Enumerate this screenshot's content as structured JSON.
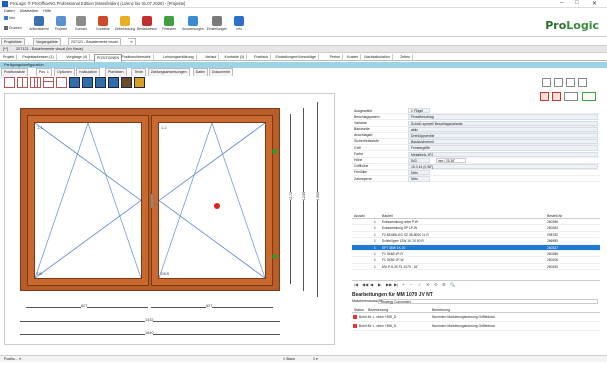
{
  "window": {
    "title": "ProLogic ® ProOfficeNG Professional Edition (Mossfelden) (Lizenz bis 31.07.2025) - [Projekte]",
    "min": "–",
    "max": "□",
    "close": "✕"
  },
  "menu": [
    "Daten",
    "Illustration",
    "Hilfe"
  ],
  "ribbon": {
    "small": [
      {
        "label": "Neu",
        "icon": "new-icon"
      },
      {
        "label": "Drucken",
        "icon": "print-icon"
      }
    ],
    "large": [
      {
        "label": "Artikelstamm",
        "icon": "articles-icon",
        "color": "#3a6fb0"
      },
      {
        "label": "Projekte",
        "icon": "projects-icon",
        "color": "#5a8fd0"
      },
      {
        "label": "Kontakt",
        "icon": "contact-icon",
        "color": "#8a8a8a"
      },
      {
        "label": "Kontakte",
        "icon": "contacts-icon",
        "color": "#d04a2a"
      },
      {
        "label": "Zeiterfassung",
        "icon": "time-icon",
        "color": "#e8b020"
      },
      {
        "label": "Bestellwesen",
        "icon": "order-icon",
        "color": "#c03030"
      },
      {
        "label": "Finanzen",
        "icon": "finance-icon",
        "color": "#40a040"
      },
      {
        "label": "Auswertungen",
        "icon": "chart-icon",
        "color": "#3a8ad0"
      },
      {
        "label": "Einstellungen",
        "icon": "settings-icon",
        "color": "#7a7a7a"
      },
      {
        "label": "Info",
        "icon": "info-icon",
        "color": "#2a70c8"
      }
    ],
    "logo_a": "Pro",
    "logo_b": "Logic"
  },
  "doc_tabs": [
    "Projektliste",
    "Vorgangsliste",
    "207121 - Bauelemente visual",
    "✕"
  ],
  "pathbar": {
    "text": "207121 - Bauelemente visual (Im Haus)",
    "marker": "[**]"
  },
  "section_tabs": [
    "Projekt",
    "Projektadressen (1)",
    "Vorgänge (4)",
    "POSITIONEN",
    "Positionsübersicht",
    "Leistungserklärung",
    "Verlauf",
    "Kontakte (3)",
    "Postfach",
    "Einstellungen/Vorschläge",
    "Preise",
    "Kosten",
    "Nachkalkulation",
    "Zeiten"
  ],
  "fstrip": "Fertigungskonfiguration",
  "sub_tabs": [
    "Positionsliste",
    "Pos. 1",
    "Optionen",
    "Kalkulation",
    "Planlisten",
    "Texte",
    "Zahlungsanweisungen",
    "Daten",
    "Dokumente"
  ],
  "drawing": {
    "sash_left": "1.1",
    "sash_right": "1.2",
    "sash_left_bottom": "DK",
    "sash_right_bottom": "DKS",
    "dim_bottom_1": "627",
    "dim_bottom_2": "627",
    "dim_total_1": "1432",
    "dim_total_2": "1640",
    "dim_right_1": "1172",
    "dim_right_2": "1230",
    "dim_right_3": "1350"
  },
  "status": {
    "left": "Positio...  ✕",
    "zoom": "1 Stack",
    "dropdown": "1 ▾"
  },
  "props": [
    {
      "k": "Ausgewählt",
      "v": "1 Flügel",
      "short": true
    },
    {
      "k": "Beschlagsystem",
      "v": "Pinselbeschlag"
    },
    {
      "k": "Variante",
      "v": "Schloß speziell Beschlagsvariante"
    },
    {
      "k": "Bandseite",
      "v": "aktiv"
    },
    {
      "k": "Anschlagart",
      "v": "Drehkippventile"
    },
    {
      "k": "Sicherheitsstufe",
      "v": "Basissicherheit"
    },
    {
      "k": "Griff",
      "v": "Fenstergriffe"
    },
    {
      "k": "Farbe",
      "v": "Metallbeis 1P2"
    },
    {
      "k": "Höhe",
      "v": "543",
      "short": true,
      "extra": "mm / 25.38\""
    },
    {
      "k": "Griffhöhe",
      "v": "15.0 44 (0.96\")"
    },
    {
      "k": "Fehlüller",
      "v": "Nein",
      "short": true
    },
    {
      "k": "Zahnsperre",
      "v": "Nein",
      "short": true
    }
  ],
  "grid": {
    "headers": {
      "anzahl": "Anzahl",
      "bauteil": "Bauteil",
      "bestell": "Bestell-Nr"
    },
    "rows": [
      {
        "n": "1",
        "name": "Ecksammlung unter P.W",
        "nr": "260286"
      },
      {
        "n": "1",
        "name": "Ecksammlung SP 1P-W",
        "nr": "260283"
      },
      {
        "n": "1",
        "name": "F2 6E4BK-EG SZ 38-8000 1L R",
        "nr": "298782"
      },
      {
        "n": "1",
        "name": "Schließgetr 12W 1K 20 00 R",
        "nr": "286985"
      },
      {
        "n": "1",
        "name": "EFT 36W 1K 20",
        "nr": "260327",
        "sel": true
      },
      {
        "n": "1",
        "name": "F1 3K68 1P-R",
        "nr": "260286"
      },
      {
        "n": "1",
        "name": "F1 3K56 1P-W",
        "nr": "260206"
      },
      {
        "n": "1",
        "name": "MV-P-8-30 PL 1070 . 16\"",
        "nr": "260330"
      }
    ]
  },
  "navbar": [
    "|◀",
    "◀◀",
    "◀",
    "▶",
    "▶▶",
    "▶|",
    "+",
    "−",
    "✓",
    "✕",
    "⟲",
    "☰",
    "🔍"
  ],
  "edits": {
    "title": "Bearbeitungen für MM 1070 JV NT",
    "machine_label": "Maschinenauswahl",
    "machine_value": "Strategy Consumers",
    "th_status": "Status",
    "th_name": "Bezeichnung",
    "th_note": "Bemerkung",
    "rows": [
      {
        "name": "Bohrl für  <- oben +305_D",
        "note": "Nummern Markierungsbohrung Griffeldmal."
      },
      {
        "name": "Bohrl für  <- oben +306_D",
        "note": "Nummern Markierungsbohrung Griffeldmal."
      }
    ]
  }
}
